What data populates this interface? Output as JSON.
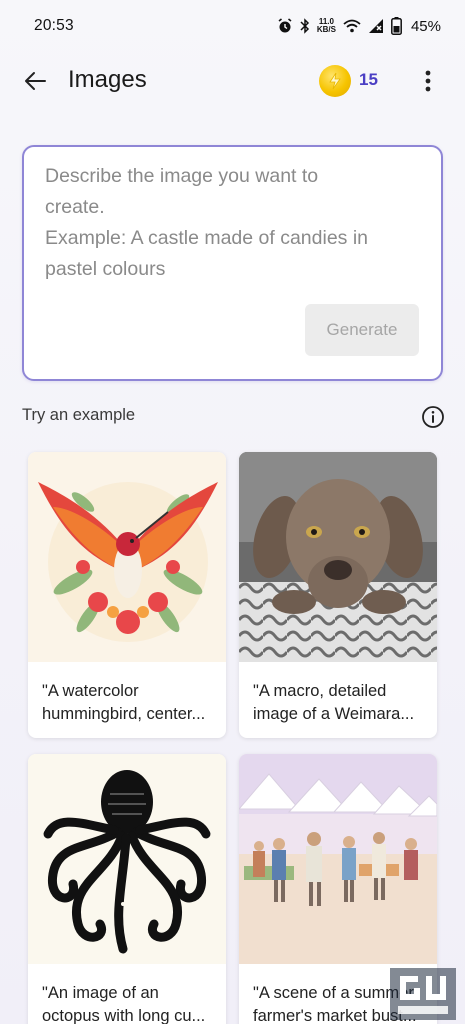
{
  "status_bar": {
    "time": "20:53",
    "net_speed_value": "11.0",
    "net_speed_unit": "KB/S",
    "battery": "45%",
    "icons": [
      "alarm-icon",
      "bluetooth-icon",
      "wifi-icon",
      "signal-off-icon",
      "battery-icon"
    ]
  },
  "header": {
    "title": "Images",
    "coin_count": "15",
    "icons": [
      "back-arrow-icon",
      "coin-icon",
      "more-vertical-icon"
    ]
  },
  "prompt": {
    "placeholder_line1": "Describe the image you want to",
    "placeholder_line2": "create.",
    "placeholder_line3": "Example: A castle made of candies in",
    "placeholder_line4": "pastel colours",
    "generate_label": "Generate"
  },
  "examples": {
    "section_label": "Try an example",
    "cards": [
      {
        "line1": "\"A watercolor",
        "line2": "hummingbird, center..."
      },
      {
        "line1": "\"A macro, detailed",
        "line2": "image of a Weimara..."
      },
      {
        "line1": "\"An image of an",
        "line2": "octopus with long cu..."
      },
      {
        "line1": "\"A scene of a summer",
        "line2": "farmer's market bust..."
      }
    ]
  },
  "watermark": {
    "text": "GADGETS TO USE"
  },
  "colors": {
    "accent": "#4b3fc4",
    "prompt_border": "#8f86d6",
    "coin": "#f6c400"
  }
}
